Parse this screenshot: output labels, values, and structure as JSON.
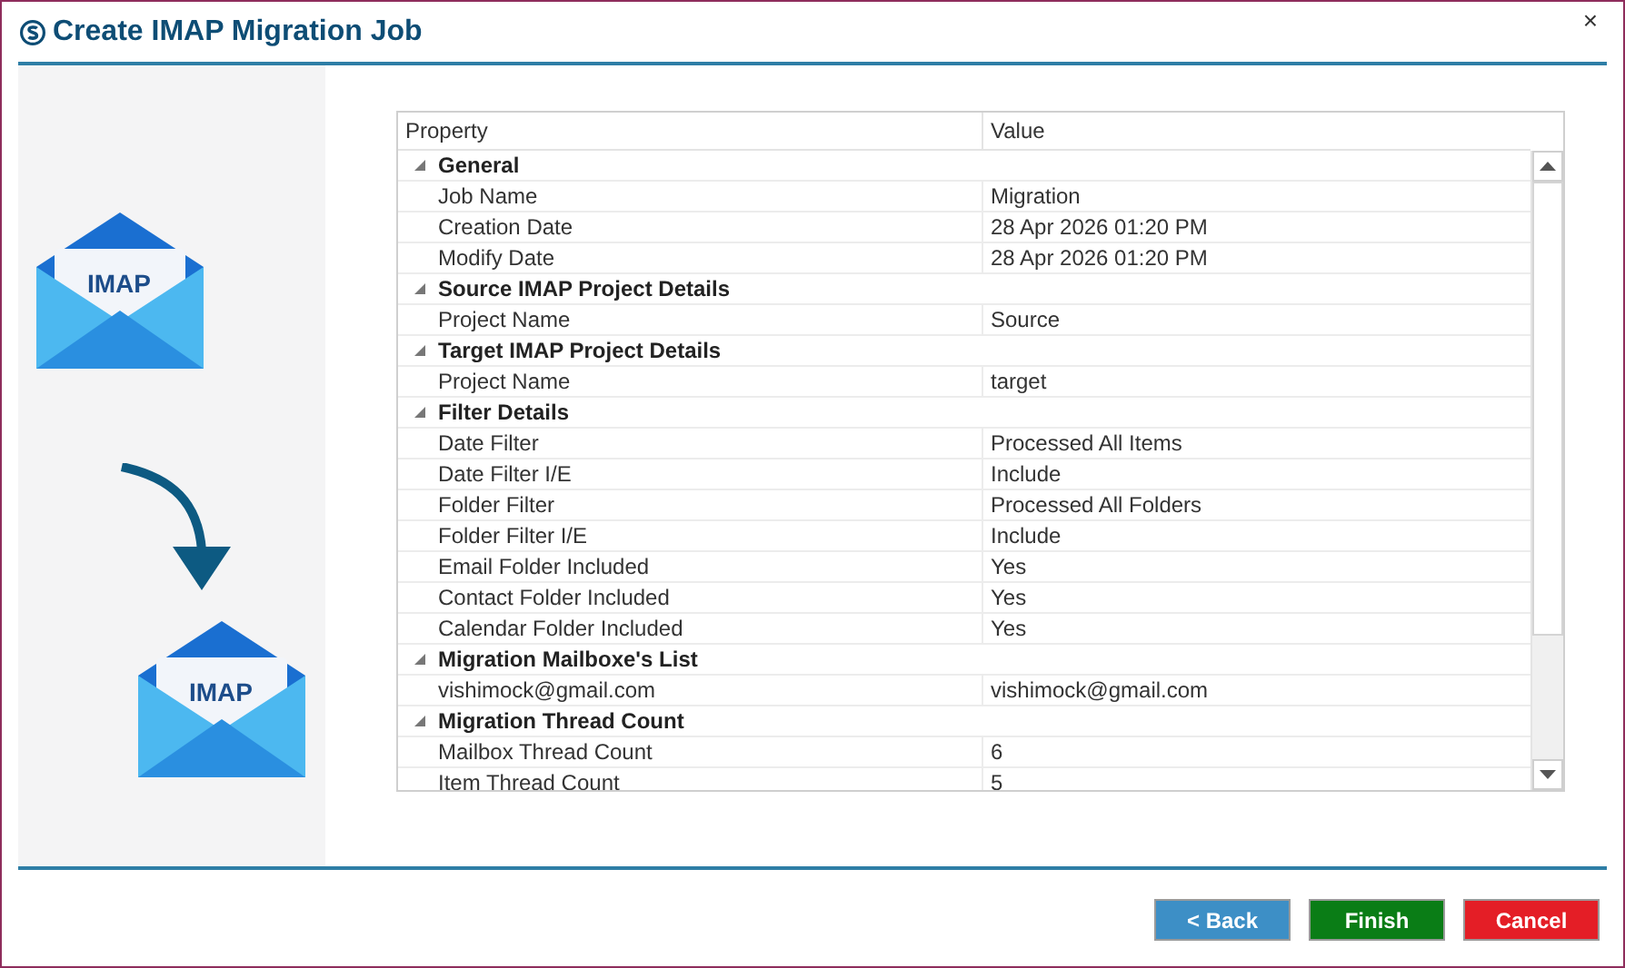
{
  "window": {
    "title": "Create IMAP Migration Job",
    "close": "×"
  },
  "illustration": {
    "source_label": "IMAP",
    "target_label": "IMAP"
  },
  "grid": {
    "columns": [
      "Property",
      "Value"
    ],
    "groups": [
      {
        "title": "General",
        "expanded": true,
        "items": [
          {
            "property": "Job Name",
            "value": "Migration"
          },
          {
            "property": "Creation Date",
            "value": "28 Apr 2026 01:20 PM"
          },
          {
            "property": "Modify Date",
            "value": "28 Apr 2026 01:20 PM"
          }
        ]
      },
      {
        "title": "Source IMAP Project Details",
        "expanded": true,
        "items": [
          {
            "property": "Project Name",
            "value": "Source"
          }
        ]
      },
      {
        "title": "Target IMAP Project Details",
        "expanded": true,
        "items": [
          {
            "property": "Project Name",
            "value": "target"
          }
        ]
      },
      {
        "title": "Filter Details",
        "expanded": true,
        "items": [
          {
            "property": "Date Filter",
            "value": "Processed All Items"
          },
          {
            "property": "Date Filter I/E",
            "value": "Include"
          },
          {
            "property": "Folder Filter",
            "value": "Processed All Folders"
          },
          {
            "property": "Folder Filter I/E",
            "value": "Include"
          },
          {
            "property": "Email Folder Included",
            "value": "Yes"
          },
          {
            "property": "Contact Folder Included",
            "value": "Yes"
          },
          {
            "property": "Calendar Folder Included",
            "value": "Yes"
          }
        ]
      },
      {
        "title": "Migration Mailboxe's List",
        "expanded": true,
        "items": [
          {
            "property": "vishimock@gmail.com",
            "value": "vishimock@gmail.com"
          }
        ]
      },
      {
        "title": "Migration Thread Count",
        "expanded": true,
        "items": [
          {
            "property": "Mailbox Thread Count",
            "value": "6"
          },
          {
            "property": "Item Thread Count",
            "value": "5"
          }
        ]
      }
    ]
  },
  "buttons": [
    {
      "label": "< Back",
      "kind": "back"
    },
    {
      "label": "Finish",
      "kind": "finish"
    },
    {
      "label": "Cancel",
      "kind": "cancel"
    }
  ]
}
